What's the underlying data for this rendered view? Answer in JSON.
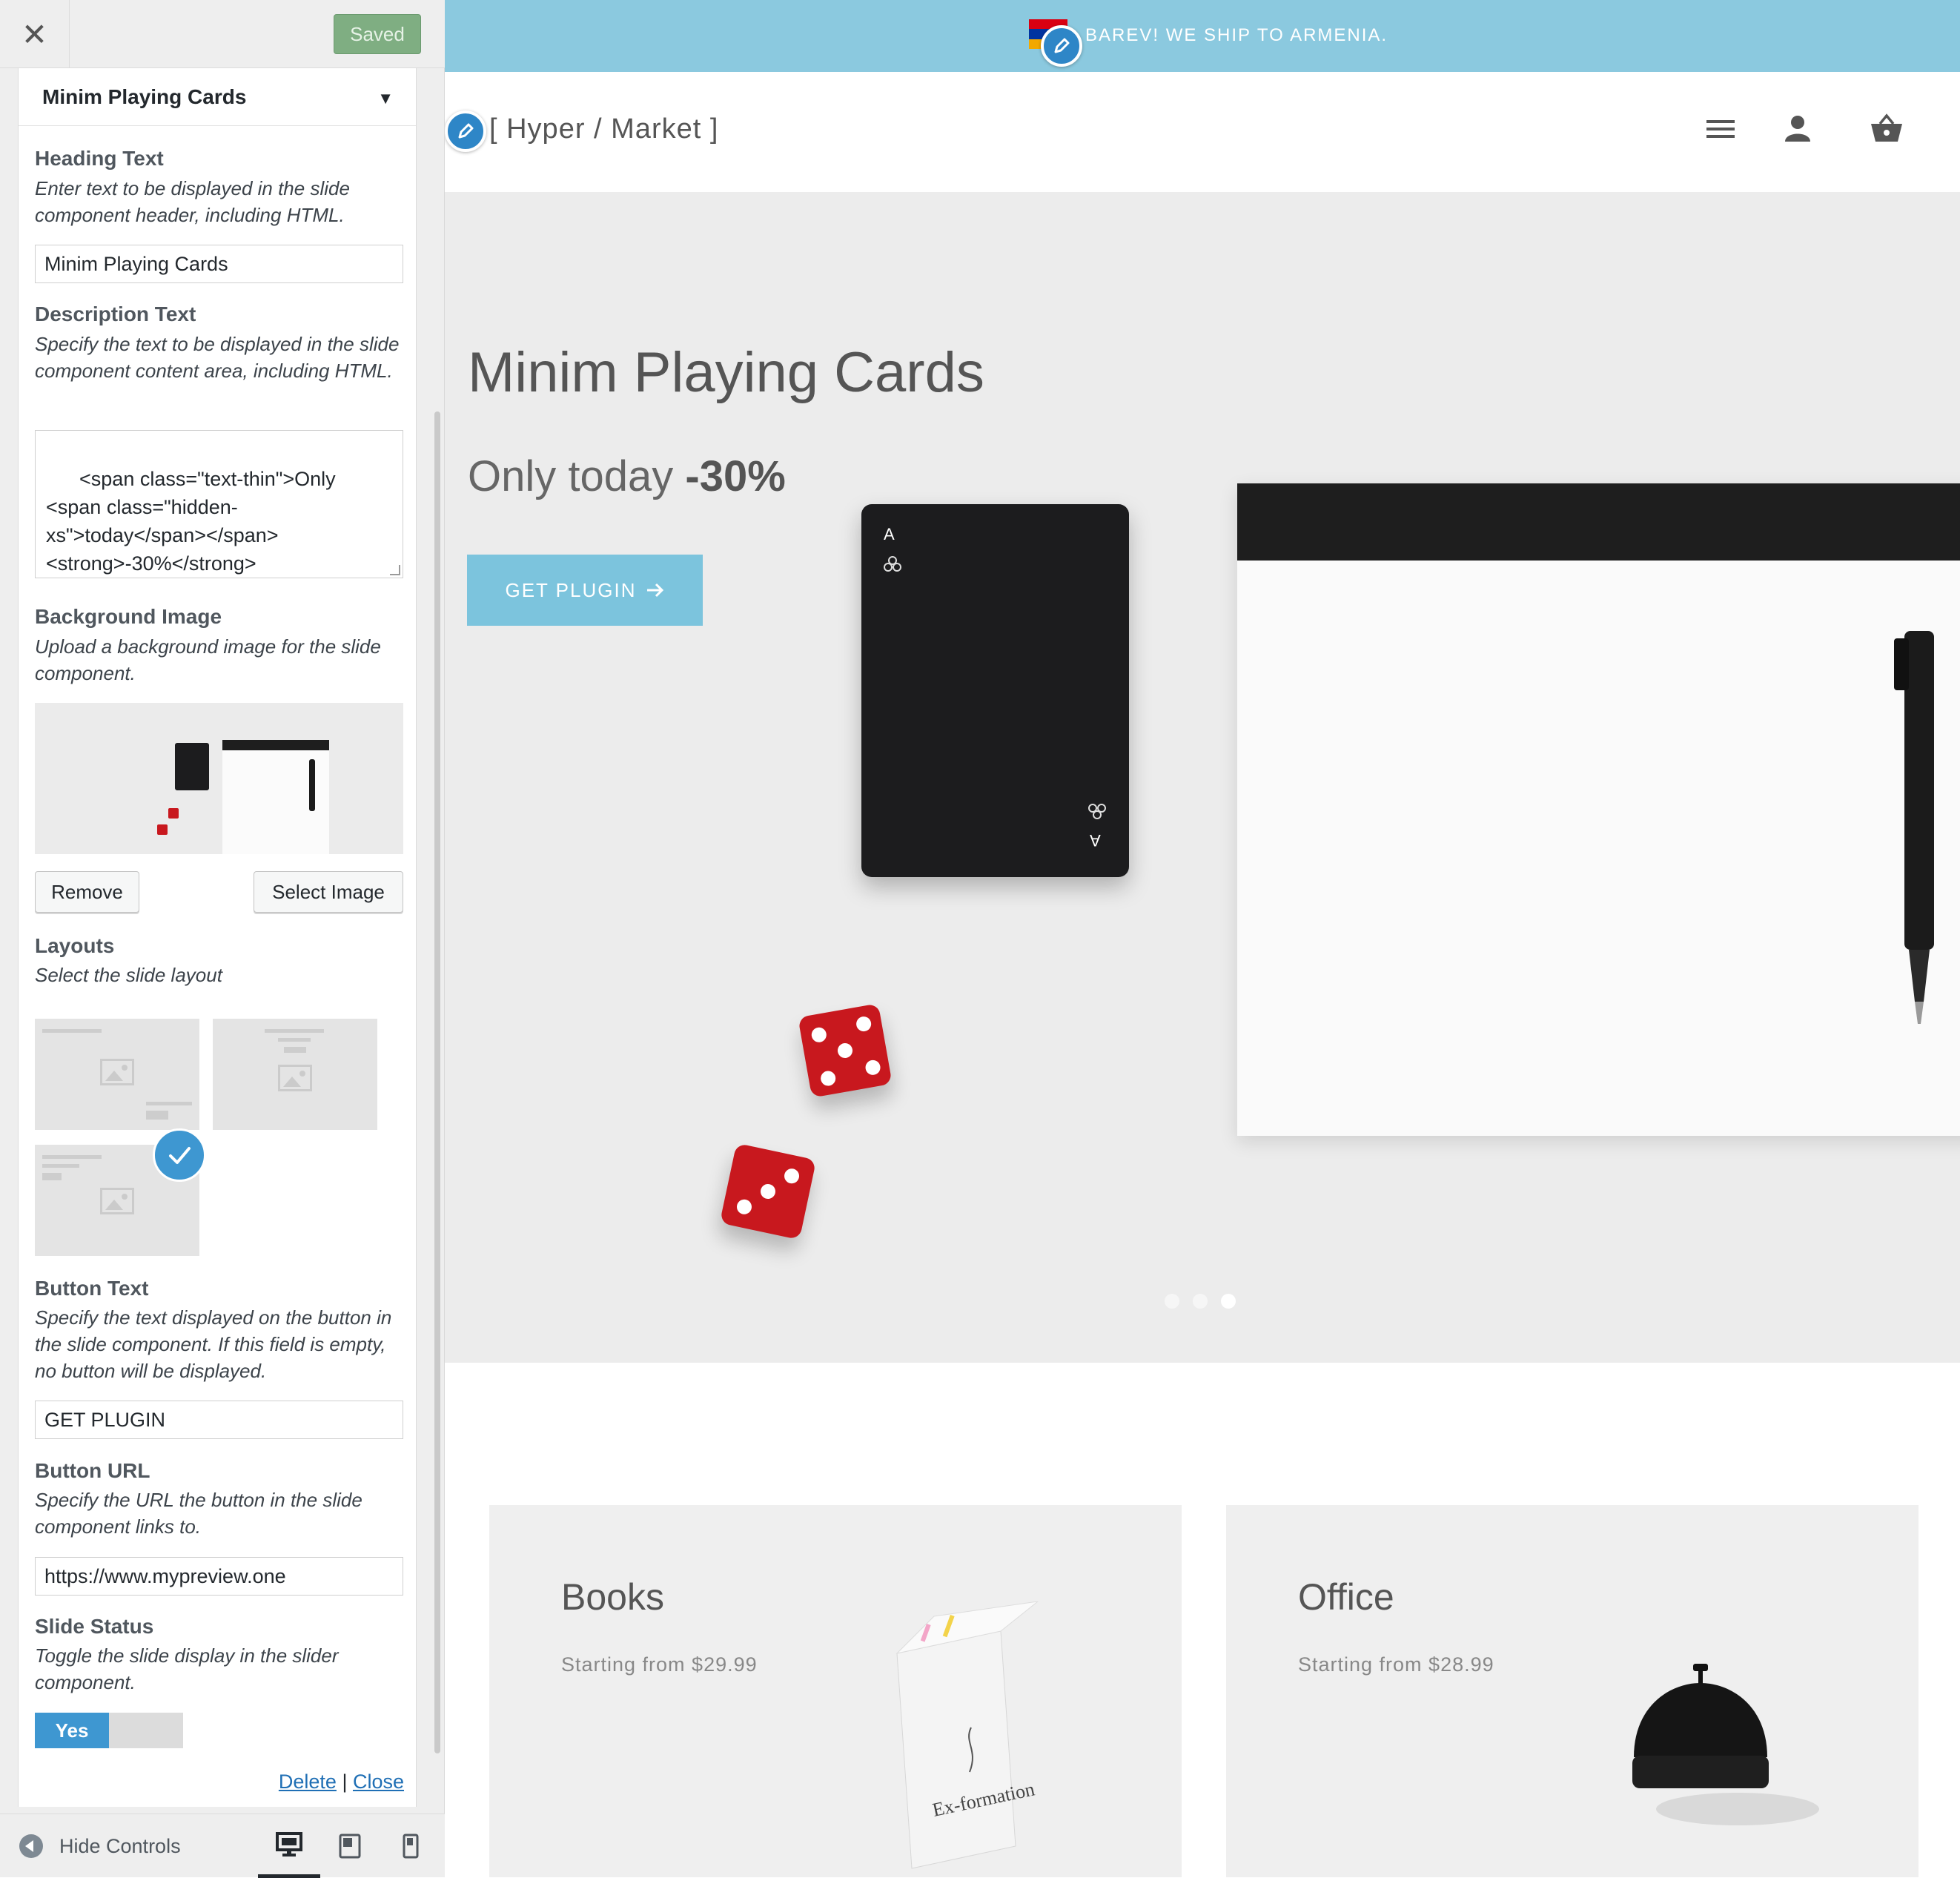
{
  "customizer": {
    "close_icon": "close-icon",
    "saved_label": "Saved",
    "section_title": "Minim Playing Cards",
    "heading": {
      "label": "Heading Text",
      "description": "Enter text to be displayed in the slide component header, including HTML.",
      "value": "Minim Playing Cards"
    },
    "description": {
      "label": "Description Text",
      "description": "Specify the text to be displayed in the slide component content area, including HTML.",
      "value": "<span class=\"text-thin\">Only\n<span class=\"hidden-\nxs\">today</span></span>\n<strong>-30%</strong>"
    },
    "background": {
      "label": "Background Image",
      "description": "Upload a background image for the slide component.",
      "remove_label": "Remove",
      "select_label": "Select Image"
    },
    "layouts": {
      "label": "Layouts",
      "description": "Select the slide layout",
      "selected_index": 2
    },
    "button_text": {
      "label": "Button Text",
      "description": "Specify the text displayed on the button in the slide component. If this field is empty, no button will be displayed.",
      "value": "GET PLUGIN"
    },
    "button_url": {
      "label": "Button URL",
      "description": "Specify the URL the button in the slide component links to.",
      "value": "https://www.mypreview.one"
    },
    "slide_status": {
      "label": "Slide Status",
      "description": "Toggle the slide display in the slider component.",
      "toggle_label": "Yes",
      "enabled": true
    },
    "delete_label": "Delete",
    "close_label": "Close",
    "separator": "|",
    "hide_controls_label": "Hide Controls"
  },
  "preview": {
    "topbar_text": "BAREV! WE SHIP TO ARMENIA.",
    "logo": "[ Hyper / Market ]",
    "hero_title": "Minim Playing Cards",
    "hero_sub_thin": "Only today",
    "hero_sub_strong": "-30%",
    "hero_button": "GET PLUGIN",
    "card_letter": "A",
    "slider_dots": 3,
    "active_dot": 2,
    "categories": [
      {
        "title": "Books",
        "subtitle": "Starting from $29.99"
      },
      {
        "title": "Office",
        "subtitle": "Starting from $28.99"
      }
    ]
  },
  "colors": {
    "accent_blue": "#3e97d1",
    "topbar": "#8bc9df",
    "hero_button": "#7cc4dd",
    "saved_green": "#7fae82",
    "die_red": "#c8181e"
  }
}
